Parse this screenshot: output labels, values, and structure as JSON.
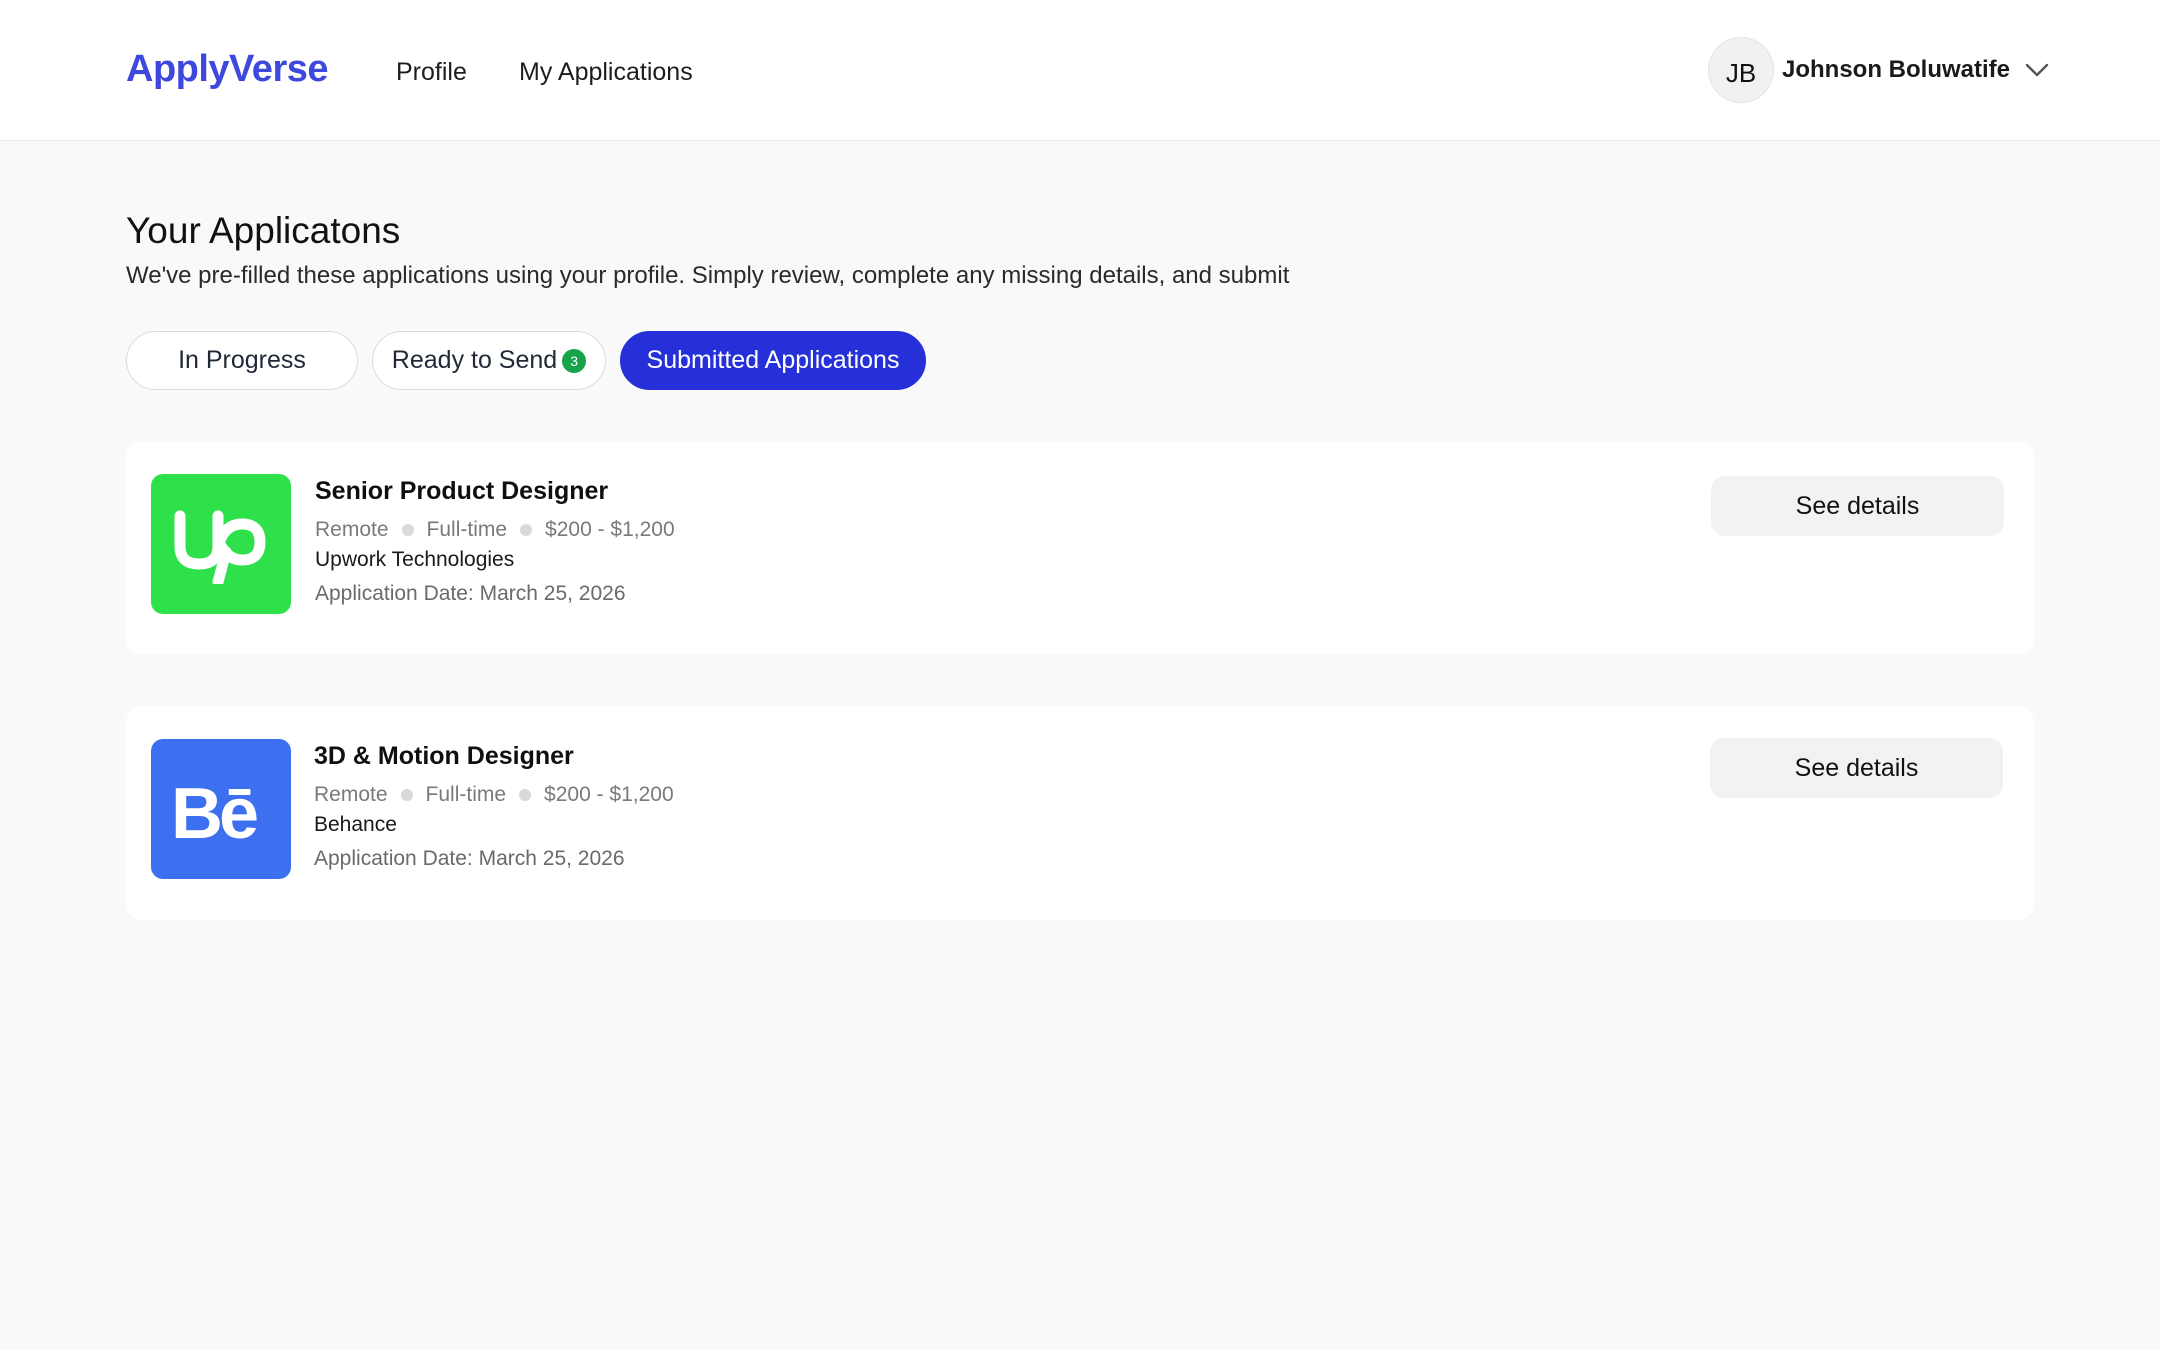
{
  "header": {
    "brand": "ApplyVerse",
    "nav": [
      {
        "label": "Profile"
      },
      {
        "label": "My Applications"
      }
    ],
    "user": {
      "initials": "JB",
      "name": "Johnson Boluwatife"
    }
  },
  "page": {
    "title": "Your Applicatons",
    "subtitle": "We've pre-filled these applications using your profile. Simply review, complete any missing details, and submit"
  },
  "tabs": [
    {
      "label": "In Progress",
      "active": false
    },
    {
      "label": "Ready to Send",
      "badge": "3",
      "active": false
    },
    {
      "label": "Submitted Applications",
      "active": true
    }
  ],
  "applications": [
    {
      "logo": "upwork-logo-icon",
      "logo_color": "#2ee04a",
      "title": "Senior Product Designer",
      "location": "Remote",
      "type": "Full-time",
      "salary": "$200 - $1,200",
      "company": "Upwork Technologies",
      "date": "Application Date: March 25, 2026",
      "action": "See details"
    },
    {
      "logo": "behance-logo-icon",
      "logo_color": "#3d6ff1",
      "title": "3D & Motion Designer",
      "location": "Remote",
      "type": "Full-time",
      "salary": "$200 - $1,200",
      "company": "Behance",
      "date": "Application Date: March 25, 2026",
      "action": "See details"
    }
  ],
  "colors": {
    "brand": "#3f48dc",
    "active_tab": "#2530d8",
    "badge": "#16a34a"
  }
}
